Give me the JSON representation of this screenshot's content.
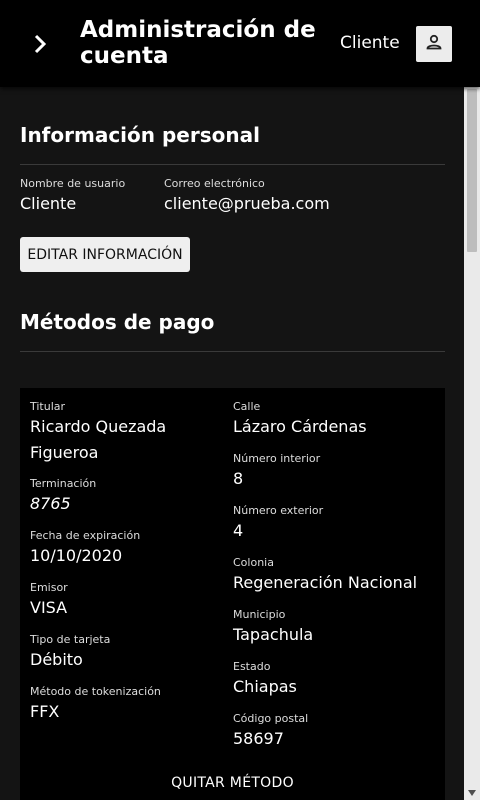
{
  "header": {
    "title": "Administración de cuenta",
    "user_label": "Cliente",
    "nav_icon": "chevron-right-icon",
    "avatar_icon": "person-icon"
  },
  "personal": {
    "title": "Información personal",
    "username_label": "Nombre de usuario",
    "username": "Cliente",
    "email_label": "Correo electrónico",
    "email": "cliente@prueba.com",
    "edit_button": "EDITAR INFORMACIÓN"
  },
  "payment": {
    "title": "Métodos de pago",
    "card": {
      "holder_label": "Titular",
      "holder": "Ricardo Quezada Figueroa",
      "termination_label": "Terminación",
      "termination": "8765",
      "expiration_label": "Fecha de expiración",
      "expiration": "10/10/2020",
      "issuer_label": "Emisor",
      "issuer": "VISA",
      "card_type_label": "Tipo de tarjeta",
      "card_type": "Débito",
      "tokenization_label": "Método de tokenización",
      "tokenization": "FFX",
      "street_label": "Calle",
      "street": "Lázaro Cárdenas",
      "interior_label": "Número interior",
      "interior": "8",
      "exterior_label": "Número exterior",
      "exterior": "4",
      "colony_label": "Colonia",
      "colony": "Regeneración Nacional",
      "municipality_label": "Municipio",
      "municipality": "Tapachula",
      "state_label": "Estado",
      "state": "Chiapas",
      "zip_label": "Código postal",
      "zip": "58697",
      "remove_button": "QUITAR MÉTODO"
    }
  },
  "colors": {
    "topbar": "#000000",
    "content_bg": "#141414",
    "card_bg": "#000000",
    "button_bg": "#efefef"
  }
}
